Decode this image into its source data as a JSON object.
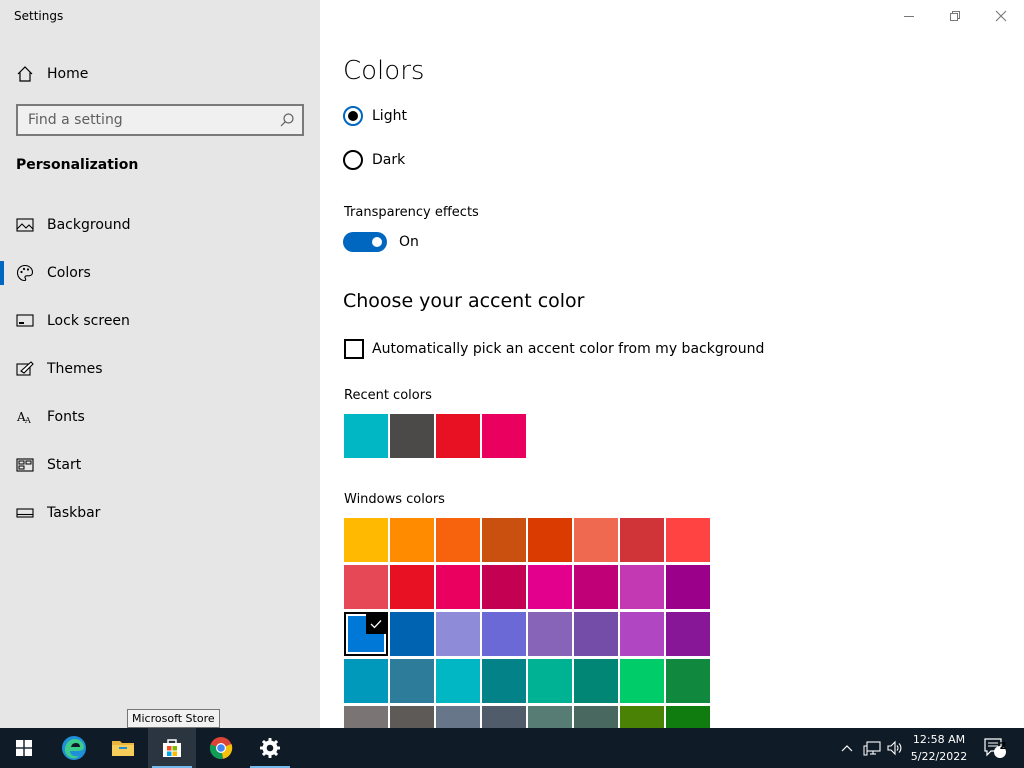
{
  "window": {
    "title": "Settings",
    "controls": [
      "minimize",
      "restore",
      "close"
    ]
  },
  "sidebar": {
    "home_label": "Home",
    "search_placeholder": "Find a setting",
    "section_title": "Personalization",
    "items": [
      {
        "label": "Background",
        "icon": "picture-icon",
        "active": false
      },
      {
        "label": "Colors",
        "icon": "palette-icon",
        "active": true
      },
      {
        "label": "Lock screen",
        "icon": "lock-screen-icon",
        "active": false
      },
      {
        "label": "Themes",
        "icon": "themes-icon",
        "active": false
      },
      {
        "label": "Fonts",
        "icon": "fonts-icon",
        "active": false
      },
      {
        "label": "Start",
        "icon": "start-icon",
        "active": false
      },
      {
        "label": "Taskbar",
        "icon": "taskbar-icon",
        "active": false
      }
    ]
  },
  "main": {
    "title": "Colors",
    "mode_options": [
      {
        "label": "Light",
        "checked": true
      },
      {
        "label": "Dark",
        "checked": false
      }
    ],
    "transparency": {
      "label": "Transparency effects",
      "state_label": "On",
      "on": true
    },
    "accent_heading": "Choose your accent color",
    "auto_pick_label": "Automatically pick an accent color from my background",
    "auto_pick_checked": false,
    "recent_label": "Recent colors",
    "recent_colors": [
      "#00b7c3",
      "#4c4a48",
      "#e81123",
      "#ea005e"
    ],
    "windows_label": "Windows colors",
    "windows_colors": [
      [
        "#ffb900",
        "#ff8c00",
        "#f7630c",
        "#ca5010",
        "#da3b01",
        "#ef6950",
        "#d13438",
        "#ff4343"
      ],
      [
        "#e74856",
        "#e81123",
        "#ea005e",
        "#c30052",
        "#e3008c",
        "#bf0077",
        "#c239b3",
        "#9a0089"
      ],
      [
        "#0078d7",
        "#0063b1",
        "#8e8cd8",
        "#6b69d6",
        "#8764b8",
        "#744da9",
        "#b146c2",
        "#881798"
      ],
      [
        "#0099bc",
        "#2d7d9a",
        "#00b7c3",
        "#038387",
        "#00b294",
        "#018574",
        "#00cc6a",
        "#10893e"
      ],
      [
        "#7a7574",
        "#5d5a58",
        "#68768a",
        "#515c6b",
        "#567c73",
        "#486860",
        "#498205",
        "#107c10"
      ]
    ],
    "selected_color": "#0078d7"
  },
  "taskbar": {
    "apps": [
      "start-icon",
      "edge-icon",
      "file-explorer-icon",
      "microsoft-store-icon",
      "chrome-icon",
      "settings-icon"
    ],
    "tooltip": "Microsoft Store",
    "time": "12:58 AM",
    "date": "5/22/2022",
    "notification_count": "2"
  }
}
